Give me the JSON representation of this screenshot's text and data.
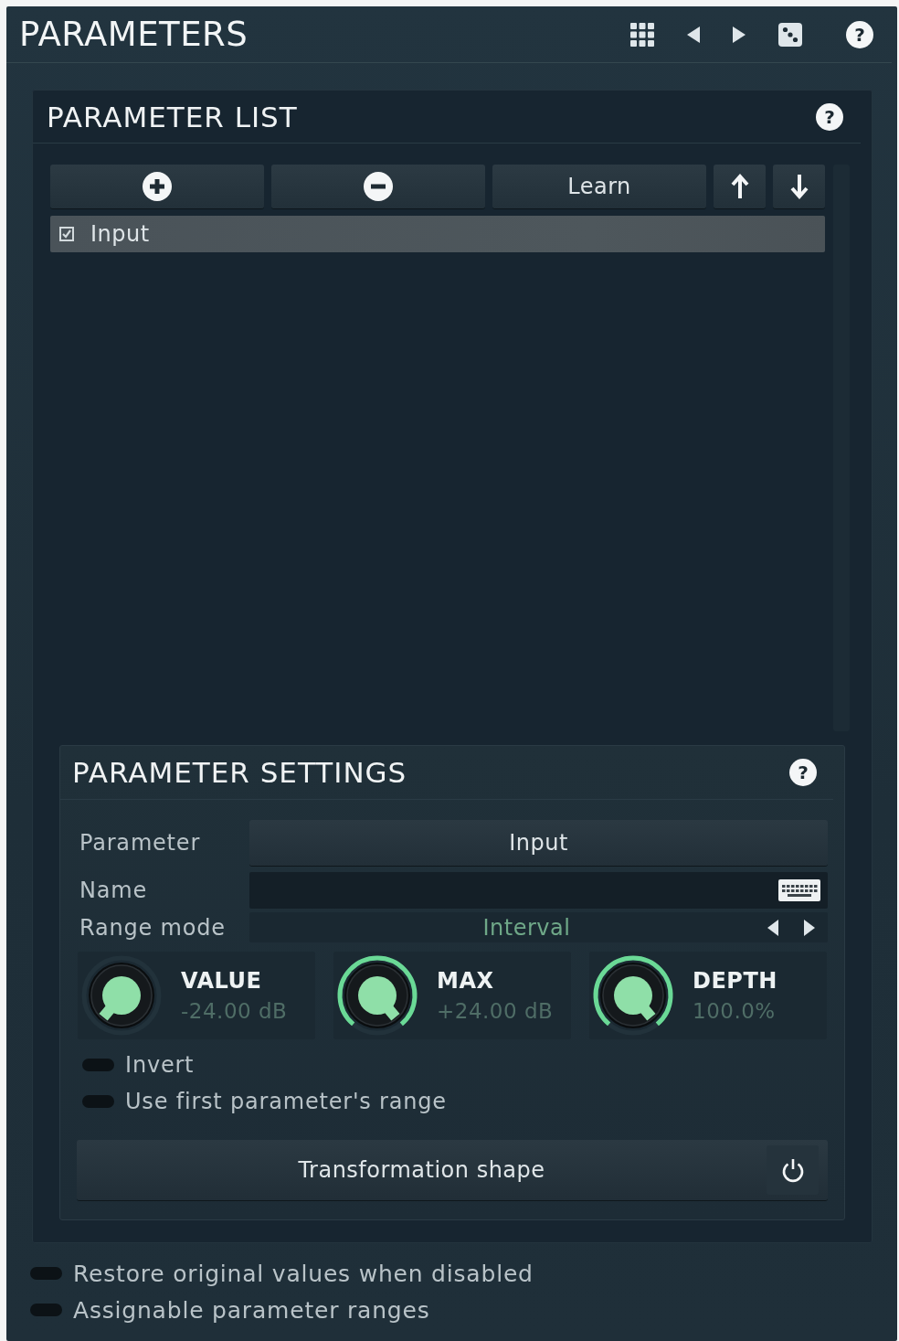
{
  "header": {
    "title": "PARAMETERS",
    "help": "?"
  },
  "parameter_list": {
    "title": "PARAMETER LIST",
    "help": "?",
    "learn_button": "Learn",
    "items": [
      {
        "label": "Input",
        "checked": true,
        "selected": true
      }
    ]
  },
  "parameter_settings": {
    "title": "PARAMETER SETTINGS",
    "help": "?",
    "parameter": {
      "label": "Parameter",
      "value": "Input"
    },
    "name": {
      "label": "Name"
    },
    "range_mode": {
      "label": "Range mode",
      "value": "Interval"
    },
    "knobs": [
      {
        "label": "VALUE",
        "reading": "-24.00 dB",
        "level": 0
      },
      {
        "label": "MAX",
        "reading": "+24.00 dB",
        "level": 1
      },
      {
        "label": "DEPTH",
        "reading": "100.0%",
        "level": 1
      }
    ],
    "toggles": [
      {
        "label": "Invert",
        "on": false
      },
      {
        "label": "Use first parameter's range",
        "on": false
      }
    ],
    "transformation_button": "Transformation shape"
  },
  "footer_toggles": [
    {
      "label": "Restore original values when disabled",
      "on": false
    },
    {
      "label": "Assignable parameter ranges",
      "on": false
    }
  ]
}
